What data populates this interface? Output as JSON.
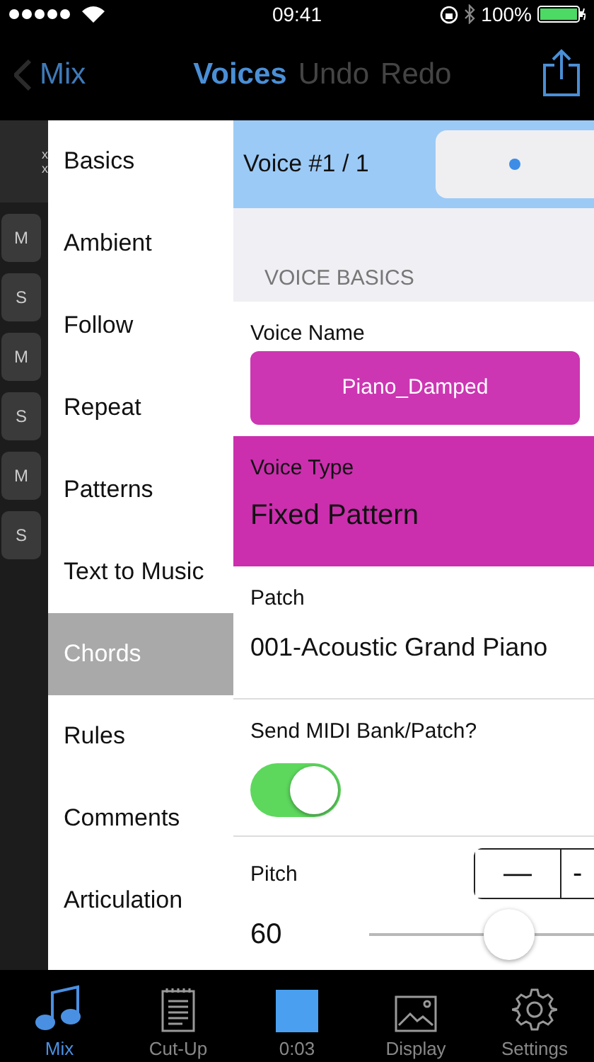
{
  "status_bar": {
    "time": "09:41",
    "battery": "100%"
  },
  "nav": {
    "back": "Mix",
    "title": "Voices",
    "actions": [
      "Undo",
      "Redo"
    ]
  },
  "strip": {
    "marks": [
      "x",
      "x"
    ],
    "buttons": [
      "M",
      "S",
      "M",
      "S",
      "M",
      "S"
    ]
  },
  "menu": [
    {
      "label": "Basics",
      "selected": false
    },
    {
      "label": "Ambient",
      "selected": false
    },
    {
      "label": "Follow",
      "selected": false
    },
    {
      "label": "Repeat",
      "selected": false
    },
    {
      "label": "Patterns",
      "selected": false
    },
    {
      "label": "Text to Music",
      "selected": false
    },
    {
      "label": "Chords",
      "selected": true
    },
    {
      "label": "Rules",
      "selected": false
    },
    {
      "label": "Comments",
      "selected": false
    },
    {
      "label": "Articulation",
      "selected": false
    }
  ],
  "voice_header": "Voice #1 / 1",
  "section": "VOICE BASICS",
  "voice_name": {
    "label": "Voice Name",
    "value": "Piano_Damped"
  },
  "voice_type": {
    "label": "Voice Type",
    "value": "Fixed Pattern"
  },
  "patch": {
    "label": "Patch",
    "value": "001-Acoustic Grand Piano"
  },
  "send_midi": {
    "label": "Send MIDI Bank/Patch?",
    "on": true
  },
  "pitch": {
    "label": "Pitch",
    "value": "60",
    "stepper": [
      "—",
      "-"
    ],
    "level": 0.62
  },
  "tabs": [
    {
      "label": "Mix",
      "selected": true,
      "kind": "notes"
    },
    {
      "label": "Cut-Up",
      "selected": false,
      "kind": "notepad"
    },
    {
      "label": "0:03",
      "selected": false,
      "kind": "stop"
    },
    {
      "label": "Display",
      "selected": false,
      "kind": "image"
    },
    {
      "label": "Settings",
      "selected": false,
      "kind": "gear"
    }
  ]
}
